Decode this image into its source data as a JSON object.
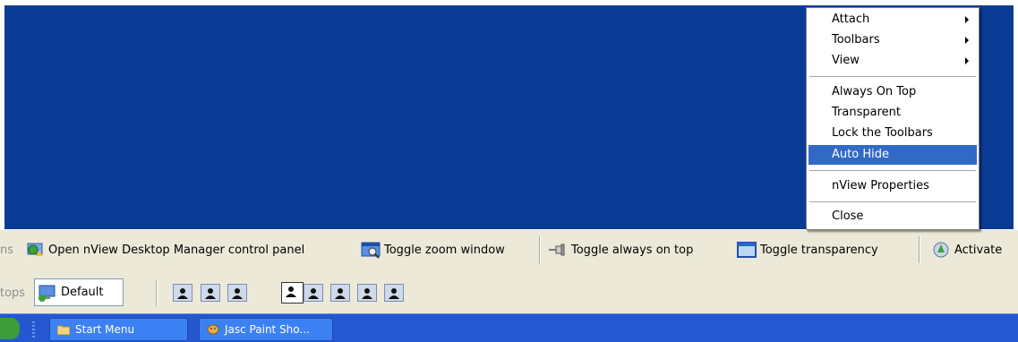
{
  "context_menu": {
    "items": [
      {
        "label": "Attach",
        "submenu": true
      },
      {
        "label": "Toolbars",
        "submenu": true
      },
      {
        "label": "View",
        "submenu": true
      },
      {
        "label": "Always On Top"
      },
      {
        "label": "Transparent"
      },
      {
        "label": "Lock the Toolbars"
      },
      {
        "label": "Auto Hide",
        "highlighted": true
      },
      {
        "label": "nView Properties"
      },
      {
        "label": "Close"
      }
    ]
  },
  "toolbar_row1": {
    "cut_label": "ns",
    "open_control_panel": "Open nView Desktop Manager control panel",
    "toggle_zoom": "Toggle zoom window",
    "toggle_always_on_top": "Toggle always on top",
    "toggle_transparency": "Toggle transparency",
    "activate": "Activate"
  },
  "toolbar_row2": {
    "cut_label": "tops",
    "default_profile": "Default",
    "desktops": [
      "Desktop 1",
      "Desktop 2",
      "Desktop 3",
      "Desktop 4",
      "Desktop 5",
      "Desktop 6",
      "Desktop 7",
      "Desktop 8"
    ],
    "selected_desktop": 4
  },
  "taskbar": {
    "buttons": [
      {
        "label": "Start Menu"
      },
      {
        "label": "Jasc Paint Sho..."
      }
    ]
  },
  "colors": {
    "desktop": "#0a3b94",
    "menu_highlight": "#316ac5",
    "taskbar": "#2457d0",
    "toolbar": "#ece9d8"
  }
}
